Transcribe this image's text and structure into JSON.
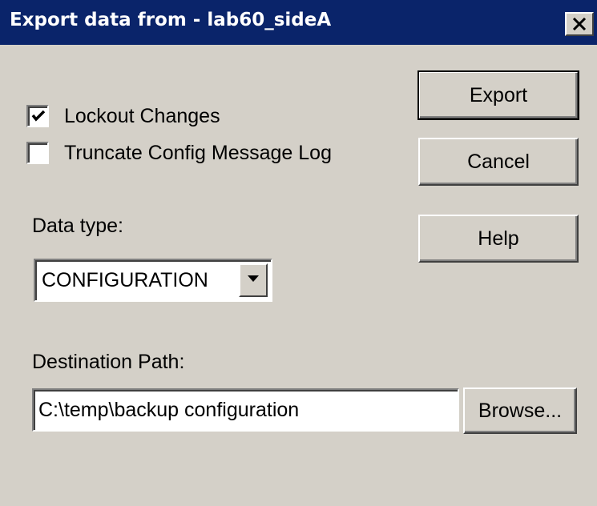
{
  "window": {
    "title": "Export data from - lab60_sideA",
    "close_icon": "close-icon"
  },
  "options": {
    "lockout_label": "Lockout Changes",
    "lockout_checked": true,
    "truncate_label": "Truncate Config Message Log",
    "truncate_checked": false
  },
  "data_type": {
    "label": "Data type:",
    "selected": "CONFIGURATION"
  },
  "destination": {
    "label": "Destination Path:",
    "value": "C:\\temp\\backup configuration",
    "browse_label": "Browse..."
  },
  "buttons": {
    "export_label": "Export",
    "cancel_label": "Cancel",
    "help_label": "Help"
  },
  "colors": {
    "titlebar": "#0a246a",
    "face": "#d4d0c8"
  }
}
